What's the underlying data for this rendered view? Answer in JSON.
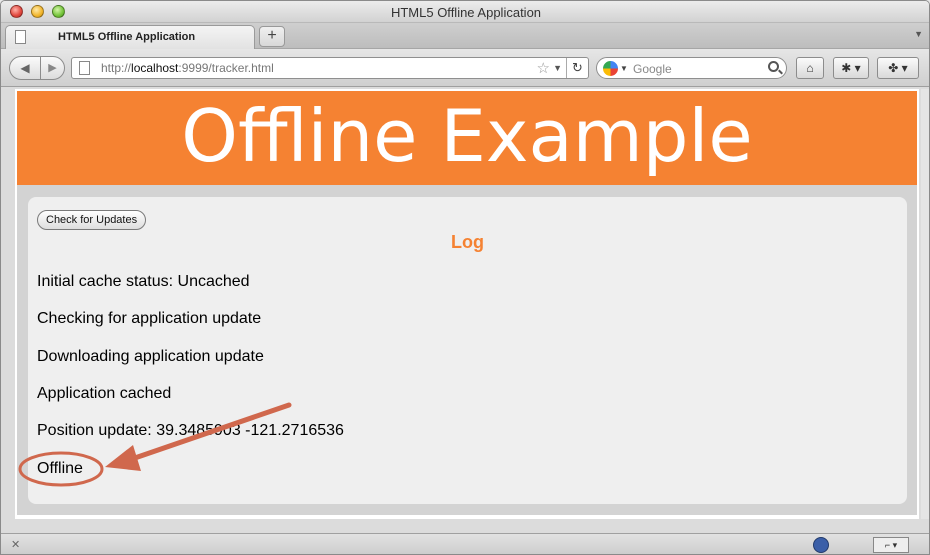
{
  "window": {
    "title": "HTML5 Offline Application"
  },
  "tabs": [
    {
      "label": "HTML5 Offline Application"
    }
  ],
  "toolbar": {
    "url_scheme": "http://",
    "url_host": "localhost",
    "url_rest": ":9999/tracker.html",
    "search_placeholder": "Google",
    "new_tab_label": "+"
  },
  "page": {
    "header_title": "Offline Example",
    "check_button_label": "Check for Updates",
    "log_title": "Log",
    "log_lines": [
      "Initial cache status: Uncached",
      "Checking for application update",
      "Downloading application update",
      "Application cached",
      "Position update: 39.3485903 -121.2716536",
      "Offline"
    ]
  },
  "colors": {
    "accent": "#f58232",
    "annotation": "#d0684d"
  },
  "icons": {
    "back": "back-arrow-icon",
    "forward": "forward-arrow-icon",
    "reload": "reload-icon",
    "home": "home-icon",
    "bookmark": "bookmark-icon",
    "search": "search-icon"
  }
}
